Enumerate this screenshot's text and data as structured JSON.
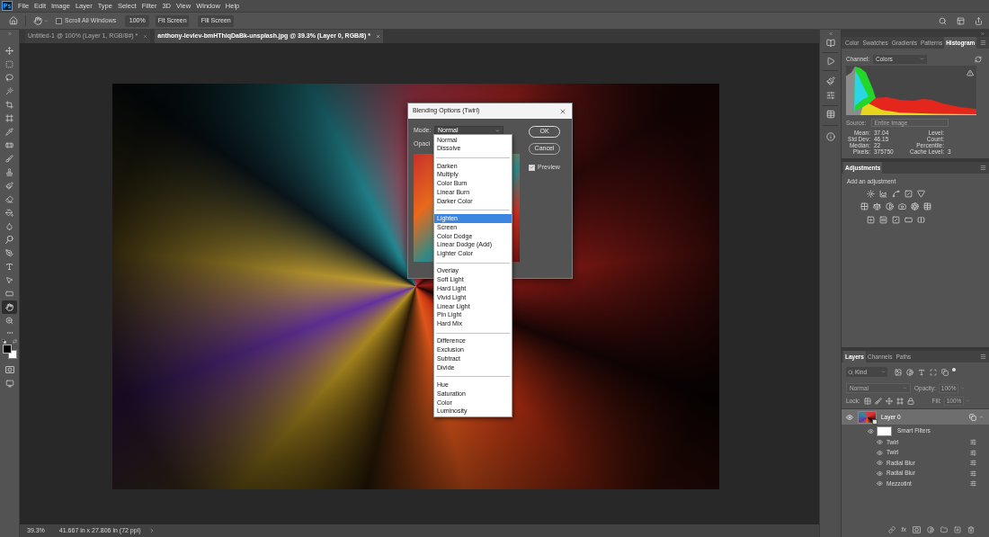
{
  "app_logo": "Ps",
  "menu_bar": [
    "File",
    "Edit",
    "Image",
    "Layer",
    "Type",
    "Select",
    "Filter",
    "3D",
    "View",
    "Window",
    "Help"
  ],
  "options_bar": {
    "scroll_all_windows": {
      "label": "Scroll All Windows",
      "checked": false
    },
    "zoom_buttons": [
      "100%",
      "Fit Screen",
      "Fill Screen"
    ]
  },
  "document_tabs": [
    {
      "label": "Untitled-1 @ 100% (Layer 1, RGB/8#) *",
      "selected": false
    },
    {
      "label": "anthony-levlev-bmHThiqDaBk-unsplash.jpg @ 39.3% (Layer 0, RGB/8) *",
      "selected": true
    }
  ],
  "toolbar": {
    "tools": [
      {
        "selected": false
      },
      {
        "selected": false
      },
      {
        "selected": false
      },
      {
        "selected": false
      },
      {
        "selected": false
      },
      {
        "selected": false
      },
      {
        "selected": false
      },
      {
        "selected": false
      },
      {
        "selected": false
      },
      {
        "selected": false
      },
      {
        "selected": false
      },
      {
        "selected": false
      },
      {
        "selected": false
      },
      {
        "selected": false
      },
      {
        "selected": false
      },
      {
        "selected": false
      },
      {
        "selected": false
      },
      {
        "selected": false
      },
      {
        "selected": false
      },
      {
        "selected": true
      },
      {
        "selected": false
      }
    ]
  },
  "blending_dialog": {
    "title": "Blending Options (Twirl)",
    "mode_label": "Mode:",
    "mode_value": "Normal",
    "opacity_label": "Opaci",
    "buttons": [
      "OK",
      "Cancel"
    ],
    "preview": {
      "label": "Preview",
      "checked": true
    },
    "mode_menu": [
      {
        "items": [
          {
            "label": "Normal",
            "selected": false
          },
          {
            "label": "Dissolve",
            "selected": false
          }
        ]
      },
      {
        "items": [
          {
            "label": "Darken",
            "selected": false
          },
          {
            "label": "Multiply",
            "selected": false
          },
          {
            "label": "Color Burn",
            "selected": false
          },
          {
            "label": "Linear Burn",
            "selected": false
          },
          {
            "label": "Darker Color",
            "selected": false
          }
        ]
      },
      {
        "items": [
          {
            "label": "Lighten",
            "selected": true
          },
          {
            "label": "Screen",
            "selected": false
          },
          {
            "label": "Color Dodge",
            "selected": false
          },
          {
            "label": "Linear Dodge (Add)",
            "selected": false
          },
          {
            "label": "Lighter Color",
            "selected": false
          }
        ]
      },
      {
        "items": [
          {
            "label": "Overlay",
            "selected": false
          },
          {
            "label": "Soft Light",
            "selected": false
          },
          {
            "label": "Hard Light",
            "selected": false
          },
          {
            "label": "Vivid Light",
            "selected": false
          },
          {
            "label": "Linear Light",
            "selected": false
          },
          {
            "label": "Pin Light",
            "selected": false
          },
          {
            "label": "Hard Mix",
            "selected": false
          }
        ]
      },
      {
        "items": [
          {
            "label": "Difference",
            "selected": false
          },
          {
            "label": "Exclusion",
            "selected": false
          },
          {
            "label": "Subtract",
            "selected": false
          },
          {
            "label": "Divide",
            "selected": false
          }
        ]
      },
      {
        "items": [
          {
            "label": "Hue",
            "selected": false
          },
          {
            "label": "Saturation",
            "selected": false
          },
          {
            "label": "Color",
            "selected": false
          },
          {
            "label": "Luminosity",
            "selected": false
          }
        ]
      }
    ]
  },
  "histogram_panel": {
    "tabs": [
      {
        "label": "Color",
        "selected": false
      },
      {
        "label": "Swatches",
        "selected": false
      },
      {
        "label": "Gradients",
        "selected": false
      },
      {
        "label": "Patterns",
        "selected": false
      },
      {
        "label": "Histogram",
        "selected": true
      }
    ],
    "channel_label": "Channel:",
    "channel_value": "Colors",
    "source": {
      "label": "Source:",
      "value": "Entire Image",
      "disabled": true
    },
    "stats_left": [
      {
        "label": "Mean:",
        "value": "37.04"
      },
      {
        "label": "Std Dev:",
        "value": "46.15"
      },
      {
        "label": "Median:",
        "value": "22"
      },
      {
        "label": "Pixels:",
        "value": "375750"
      }
    ],
    "stats_right": [
      {
        "label": "Level:"
      },
      {
        "label": "Count:"
      },
      {
        "label": "Percentile:"
      },
      {
        "label": "Cache Level:",
        "value": "3"
      }
    ]
  },
  "adjustments_panel": {
    "tabs": [
      {
        "label": "Adjustments",
        "selected": true
      }
    ],
    "hint": "Add an adjustment"
  },
  "layers_panel": {
    "tabs": [
      {
        "label": "Layers",
        "selected": true
      },
      {
        "label": "Channels",
        "selected": false
      },
      {
        "label": "Paths",
        "selected": false
      }
    ],
    "filter_type": "Kind",
    "blend_mode": {
      "value": "Normal",
      "disabled": true
    },
    "opacity": {
      "label": "Opacity:",
      "value": "100%",
      "disabled": true
    },
    "lock_label": "Lock:",
    "fill": {
      "label": "Fill:",
      "value": "100%",
      "disabled": true
    },
    "layers": [
      {
        "name": "Layer 0",
        "visible": true,
        "selected": true,
        "smart_filters": {
          "label": "Smart Filters",
          "visible": true,
          "filters": [
            {
              "name": "Twirl",
              "visible": true
            },
            {
              "name": "Twirl",
              "visible": true
            },
            {
              "name": "Radial Blur",
              "visible": true
            },
            {
              "name": "Radial Blur",
              "visible": true
            },
            {
              "name": "Mezzotint",
              "visible": true
            }
          ]
        }
      }
    ],
    "footer_fx": "fx"
  },
  "status_bar": {
    "zoom": "39.3%",
    "document_size": "41.667 in x 27.806 in (72 ppi)"
  }
}
